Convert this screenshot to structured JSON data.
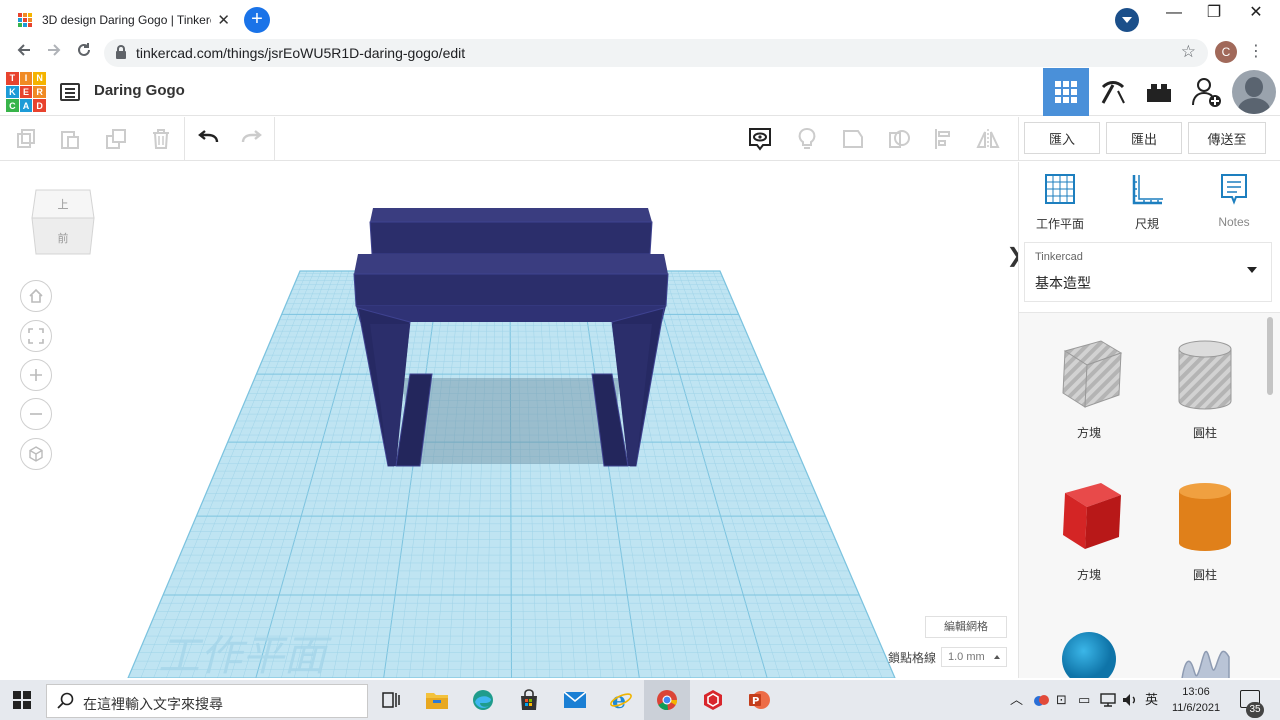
{
  "browser": {
    "tab_title": "3D design Daring Gogo | Tinkercad",
    "tab_close": "✕",
    "new_tab": "+",
    "url": "tinkercad.com/things/jsrEoWU5R1D-daring-gogo/edit",
    "profile_initial": "C",
    "window_controls": {
      "minimize": "—",
      "restore": "❐",
      "close": "✕"
    }
  },
  "app": {
    "logo_letters": [
      "T",
      "I",
      "N",
      "K",
      "E",
      "R",
      "C",
      "A",
      "D"
    ],
    "logo_colors": [
      "#e8432e",
      "#f08a24",
      "#f5b400",
      "#1d9bd7",
      "#e8432e",
      "#f08a24",
      "#38b44a",
      "#1d9bd7",
      "#e8432e"
    ],
    "project_title": "Daring Gogo",
    "accent_color": "#4a90d9"
  },
  "toolbar": {
    "import_label": "匯入",
    "export_label": "匯出",
    "send_to_label": "傳送至"
  },
  "workspace": {
    "viewcube_top": "上",
    "viewcube_front": "前",
    "workplane_watermark": "工作平面",
    "edit_grid_label": "編輯網格",
    "snap_grid_label": "鎖點格線",
    "snap_grid_value": "1.0 mm",
    "collapse_arrow": "❯",
    "object_color": "#2b2e6b"
  },
  "panel": {
    "tools": [
      {
        "label": "工作平面",
        "icon": "workplane-icon"
      },
      {
        "label": "尺規",
        "icon": "ruler-icon"
      },
      {
        "label": "Notes",
        "icon": "notes-icon"
      }
    ],
    "library_source": "Tinkercad",
    "library_category": "基本造型",
    "shapes": [
      {
        "label": "方塊",
        "icon": "box-hole-icon"
      },
      {
        "label": "圓柱",
        "icon": "cylinder-hole-icon"
      },
      {
        "label": "方塊",
        "icon": "box-icon"
      },
      {
        "label": "圓柱",
        "icon": "cylinder-icon"
      },
      {
        "label": "",
        "icon": "sphere-icon"
      },
      {
        "label": "",
        "icon": "scribble-icon"
      }
    ]
  },
  "taskbar": {
    "search_placeholder": "在這裡輸入文字來搜尋",
    "ime_label": "英",
    "time": "13:06",
    "date": "11/6/2021",
    "notification_count": "35"
  }
}
